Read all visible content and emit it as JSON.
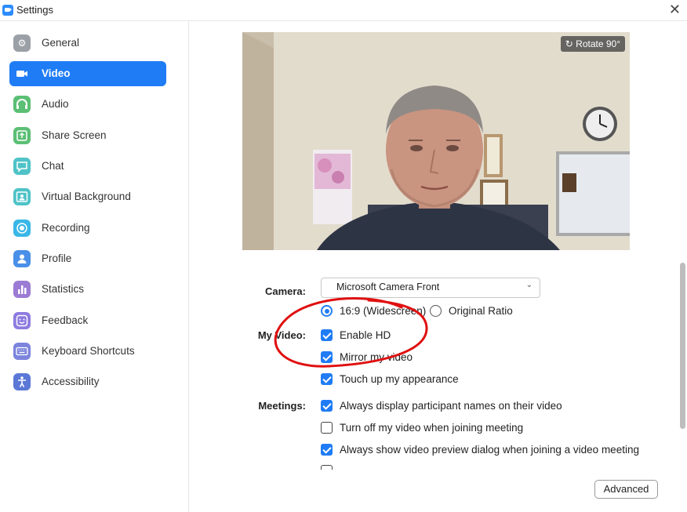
{
  "window": {
    "title": "Settings"
  },
  "sidebar": {
    "items": [
      {
        "label": "General",
        "icon": "gear-icon",
        "color": "#9aa0a6",
        "glyph": "⚙"
      },
      {
        "label": "Video",
        "icon": "video-camera-icon",
        "color": "#1f7cf5",
        "glyph": "■",
        "active": true
      },
      {
        "label": "Audio",
        "icon": "headphones-icon",
        "color": "#5bbf74",
        "glyph": "∩"
      },
      {
        "label": "Share Screen",
        "icon": "share-screen-icon",
        "color": "#5bbf74",
        "glyph": "↑"
      },
      {
        "label": "Chat",
        "icon": "chat-bubble-icon",
        "color": "#4fc3c7",
        "glyph": "▬"
      },
      {
        "label": "Virtual Background",
        "icon": "person-background-icon",
        "color": "#4fc3c7",
        "glyph": "☺"
      },
      {
        "label": "Recording",
        "icon": "record-icon",
        "color": "#39b7e6",
        "glyph": "◉"
      },
      {
        "label": "Profile",
        "icon": "profile-icon",
        "color": "#4a8fe8",
        "glyph": "●"
      },
      {
        "label": "Statistics",
        "icon": "bar-chart-icon",
        "color": "#9b7bd4",
        "glyph": "▮"
      },
      {
        "label": "Feedback",
        "icon": "smiley-icon",
        "color": "#8d7be0",
        "glyph": "☺"
      },
      {
        "label": "Keyboard Shortcuts",
        "icon": "keyboard-icon",
        "color": "#7c84dc",
        "glyph": "▦"
      },
      {
        "label": "Accessibility",
        "icon": "accessibility-icon",
        "color": "#5b78d6",
        "glyph": "♿"
      }
    ]
  },
  "preview": {
    "rotate_label": "Rotate 90°"
  },
  "camera": {
    "label": "Camera:",
    "selected": "Microsoft Camera Front",
    "ratio_options": [
      {
        "label": "16:9 (Widescreen)",
        "selected": true
      },
      {
        "label": "Original Ratio",
        "selected": false
      }
    ]
  },
  "my_video": {
    "label": "My Video:",
    "options": [
      {
        "label": "Enable HD",
        "checked": true
      },
      {
        "label": "Mirror my video",
        "checked": true
      },
      {
        "label": "Touch up my appearance",
        "checked": true
      }
    ]
  },
  "meetings": {
    "label": "Meetings:",
    "options": [
      {
        "label": "Always display participant names on their video",
        "checked": true
      },
      {
        "label": "Turn off my video when joining meeting",
        "checked": false
      },
      {
        "label": "Always show video preview dialog when joining a video meeting",
        "checked": true
      }
    ]
  },
  "advanced_label": "Advanced",
  "colors": {
    "accent": "#1f7cf5",
    "annotation": "#e01010"
  }
}
